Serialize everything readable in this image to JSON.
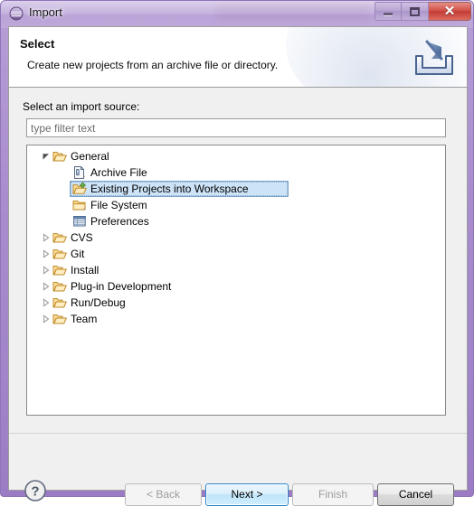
{
  "window": {
    "title": "Import",
    "app_icon": "eclipse-globe-icon",
    "controls": {
      "minimize": "minimize-icon",
      "maximize": "maximize-icon",
      "close": "close-icon"
    },
    "title_bar_color": "#a98cce",
    "frame_color": "#9b7cc4"
  },
  "banner": {
    "title": "Select",
    "description": "Create new projects from an archive file or directory.",
    "icon": "import-arrow-into-tray-icon"
  },
  "body": {
    "source_label": "Select an import source:",
    "filter": {
      "value": "",
      "placeholder": "type filter text"
    },
    "tree": [
      {
        "label": "General",
        "level": 0,
        "expanded": true,
        "icon": "open-folder-icon",
        "selected": false
      },
      {
        "label": "Archive File",
        "level": 1,
        "expanded": null,
        "icon": "archive-file-icon",
        "selected": false
      },
      {
        "label": "Existing Projects into Workspace",
        "level": 1,
        "expanded": null,
        "icon": "import-project-folder-icon",
        "selected": true
      },
      {
        "label": "File System",
        "level": 1,
        "expanded": null,
        "icon": "closed-folder-icon",
        "selected": false
      },
      {
        "label": "Preferences",
        "level": 1,
        "expanded": null,
        "icon": "preferences-grid-icon",
        "selected": false
      },
      {
        "label": "CVS",
        "level": 0,
        "expanded": false,
        "icon": "open-folder-icon",
        "selected": false
      },
      {
        "label": "Git",
        "level": 0,
        "expanded": false,
        "icon": "open-folder-icon",
        "selected": false
      },
      {
        "label": "Install",
        "level": 0,
        "expanded": false,
        "icon": "open-folder-icon",
        "selected": false
      },
      {
        "label": "Plug-in Development",
        "level": 0,
        "expanded": false,
        "icon": "open-folder-icon",
        "selected": false
      },
      {
        "label": "Run/Debug",
        "level": 0,
        "expanded": false,
        "icon": "open-folder-icon",
        "selected": false
      },
      {
        "label": "Team",
        "level": 0,
        "expanded": false,
        "icon": "open-folder-icon",
        "selected": false
      }
    ]
  },
  "footer": {
    "help": "help-icon",
    "buttons": {
      "back": {
        "label": "< Back",
        "state": "disabled"
      },
      "next": {
        "label": "Next >",
        "state": "default"
      },
      "finish": {
        "label": "Finish",
        "state": "disabled"
      },
      "cancel": {
        "label": "Cancel",
        "state": "enabled"
      }
    },
    "selection_color": "#cde3f7",
    "default_button_color": "#2c85c9"
  }
}
